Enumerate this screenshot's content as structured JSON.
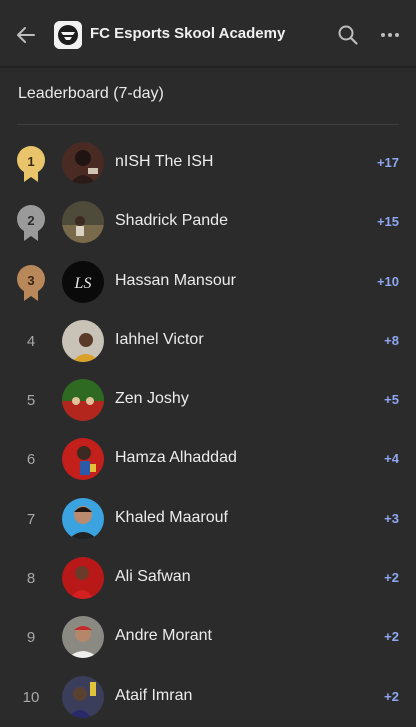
{
  "header": {
    "title": "FC Esports Skool Academy",
    "back_icon": "arrow-left-icon",
    "search_icon": "search-icon",
    "more_icon": "more-horizontal-icon"
  },
  "section": {
    "title": "Leaderboard (7-day)"
  },
  "colors": {
    "gold": "#e9c46a",
    "silver": "#9a9a9a",
    "bronze": "#b8875a",
    "score": "#8fa7f0",
    "background": "#2b2b2b"
  },
  "leaderboard": [
    {
      "rank": "1",
      "name": "nISH The ISH",
      "score": "+17"
    },
    {
      "rank": "2",
      "name": "Shadrick Pande",
      "score": "+15"
    },
    {
      "rank": "3",
      "name": "Hassan Mansour",
      "score": "+10"
    },
    {
      "rank": "4",
      "name": "Iahhel Victor",
      "score": "+8"
    },
    {
      "rank": "5",
      "name": "Zen Joshy",
      "score": "+5"
    },
    {
      "rank": "6",
      "name": "Hamza Alhaddad",
      "score": "+4"
    },
    {
      "rank": "7",
      "name": "Khaled Maarouf",
      "score": "+3"
    },
    {
      "rank": "8",
      "name": "Ali Safwan",
      "score": "+2"
    },
    {
      "rank": "9",
      "name": "Andre Morant",
      "score": "+2"
    },
    {
      "rank": "10",
      "name": "Ataif Imran",
      "score": "+2"
    }
  ]
}
